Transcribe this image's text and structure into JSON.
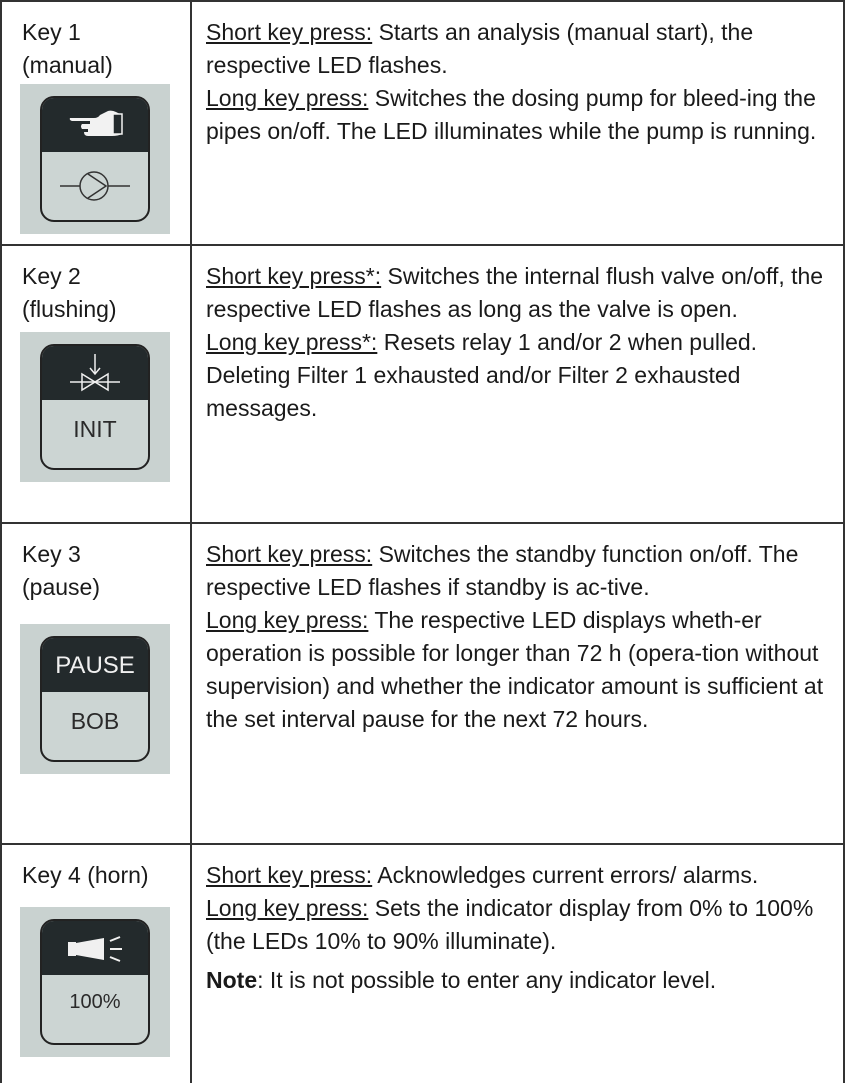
{
  "rows": [
    {
      "key": "Key 1\n(manual)",
      "icon": "hand-pump-key-icon",
      "short_label": "Short key press:",
      "short_text": " Starts an analysis (manual start), the respective LED flashes.",
      "long_label": "Long key press:",
      "long_text": " Switches the dosing pump for bleed-ing the pipes on/off. The LED illuminates while the pump is running."
    },
    {
      "key": "Key 2\n(flushing)",
      "icon": "valve-key-icon",
      "icon_bottom": "INIT",
      "short_label": "Short key press*:",
      "short_text": " Switches the internal flush valve on/off, the respective LED flashes as long as the valve is open.",
      "long_label": "Long key press*:",
      "long_text": " Resets relay 1 and/or 2 when pulled.",
      "extra": "Deleting Filter 1 exhausted and/or Filter 2 exhausted messages."
    },
    {
      "key": "Key 3\n(pause)",
      "icon": "pause-key-icon",
      "icon_top": "PAUSE",
      "icon_bottom": "BOB",
      "short_label": "Short key press:",
      "short_text": " Switches the standby function on/off. The respective LED flashes if standby is ac-tive.",
      "long_label": "Long key press:",
      "long_text": " The respective LED displays wheth-er operation is possible for longer than 72 h (opera-tion without supervision) and whether the indicator amount is sufficient at the set interval pause for the next 72 hours."
    },
    {
      "key": "Key 4 (horn)",
      "icon": "horn-key-icon",
      "icon_bottom": "100%",
      "short_label": "Short key press:",
      "short_text": " Acknowledges current errors/ alarms.",
      "long_label": "Long key press:",
      "long_text": " Sets the indicator display from 0% to 100% (the LEDs 10% to 90% illuminate).",
      "note_label": "Note",
      "note_text": ": It is not possible to enter any indicator level."
    }
  ]
}
